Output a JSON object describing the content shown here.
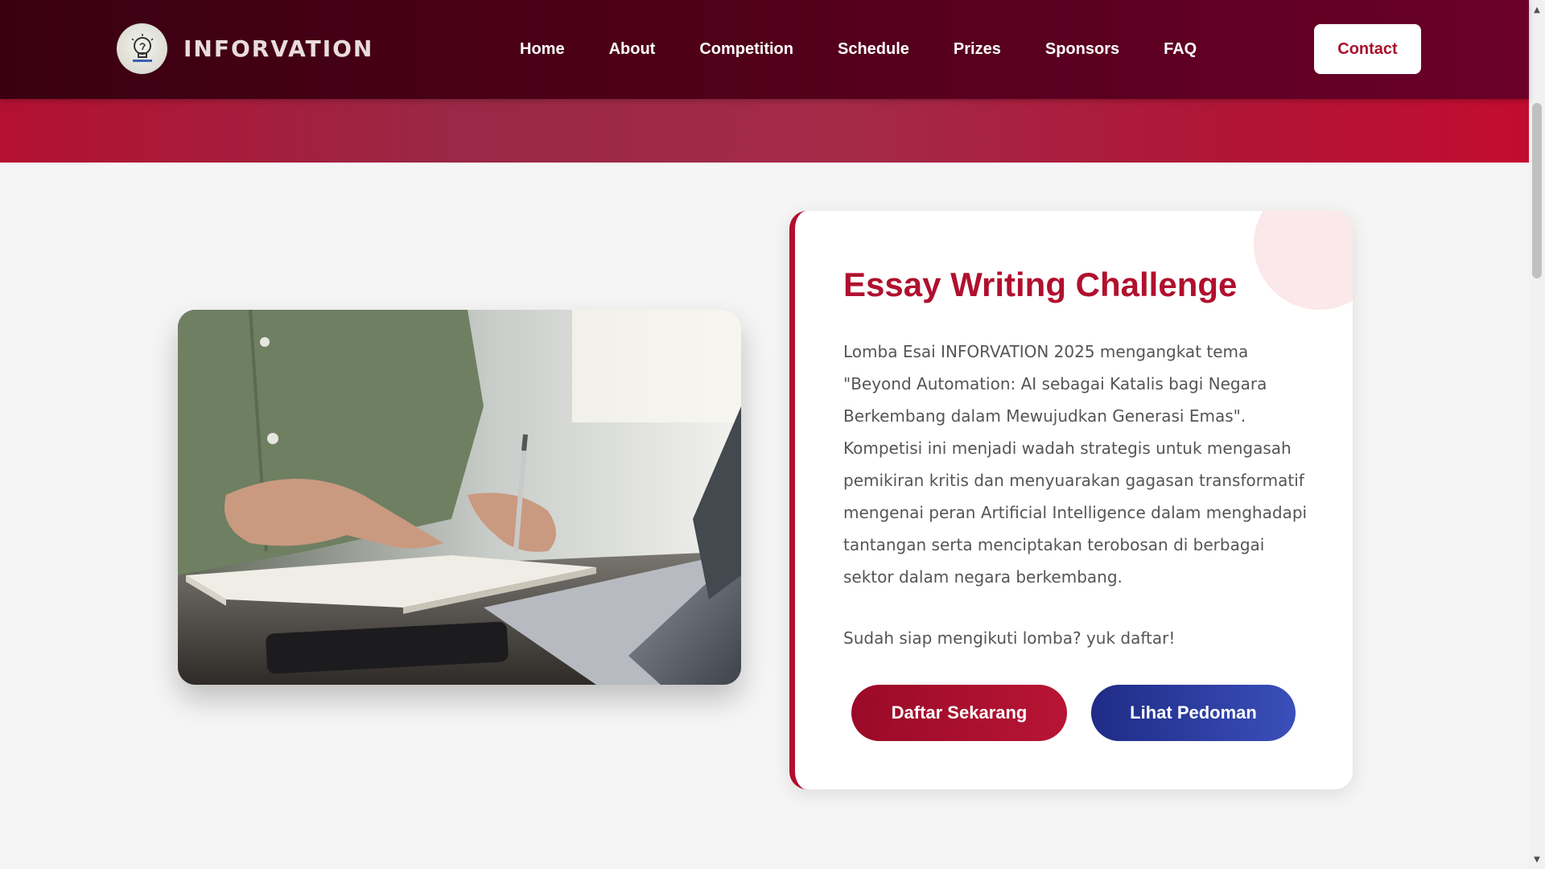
{
  "header": {
    "brand_name": "INFORVATION",
    "nav": [
      {
        "label": "Home"
      },
      {
        "label": "About"
      },
      {
        "label": "Competition"
      },
      {
        "label": "Schedule"
      },
      {
        "label": "Prizes"
      },
      {
        "label": "Sponsors"
      },
      {
        "label": "FAQ"
      }
    ],
    "contact_label": "Contact"
  },
  "card": {
    "title": "Essay Writing Challenge",
    "description": "Lomba Esai INFORVATION 2025 mengangkat tema \"Beyond Automation: AI sebagai Katalis bagi Negara Berkembang dalam Mewujudkan Generasi Emas\". Kompetisi ini menjadi wadah strategis untuk mengasah pemikiran kritis dan menyuarakan gagasan transformatif mengenai peran Artificial Intelligence dalam menghadapi tantangan serta menciptakan terobosan di berbagai sektor dalam negara berkembang.",
    "cta_text": "Sudah siap mengikuti lomba? yuk daftar!",
    "primary_button": "Daftar Sekarang",
    "secondary_button": "Lihat Pedoman"
  },
  "colors": {
    "brand_dark": "#4f0019",
    "accent_red": "#b0102e",
    "secondary_blue": "#2b3aa0"
  },
  "icons": {
    "logo": "lightbulb-logo-icon",
    "scroll_up": "scroll-up-arrow-icon",
    "scroll_down": "scroll-down-arrow-icon"
  }
}
